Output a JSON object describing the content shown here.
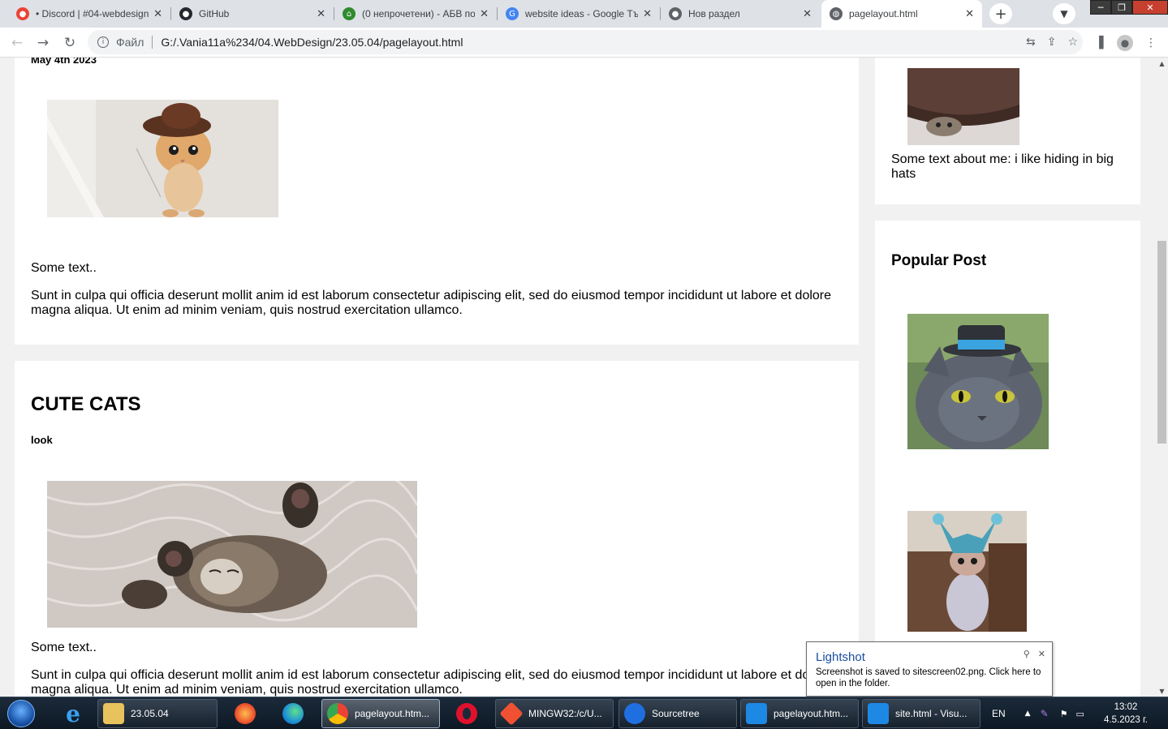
{
  "browser": {
    "tabs": [
      {
        "title": "• Discord | #04-webdesign",
        "icon": "discord-icon",
        "color": "#5865f2"
      },
      {
        "title": "GitHub",
        "icon": "github-icon",
        "color": "#24292f"
      },
      {
        "title": "(0 непрочетени) - АБВ по",
        "icon": "abv-mail-icon",
        "color": "#2e8b2e"
      },
      {
        "title": "website ideas - Google Тъ",
        "icon": "google-icon",
        "color": "#4285f4"
      },
      {
        "title": "Нов раздел",
        "icon": "chrome-icon",
        "color": "#5f6368"
      },
      {
        "title": "pagelayout.html",
        "icon": "globe-icon",
        "color": "#5f6368"
      }
    ],
    "new_tab_symbol": "+",
    "address": {
      "scheme": "Файл",
      "url": "G:/.Vania11a%234/04.WebDesign/23.05.04/pagelayout.html"
    }
  },
  "page": {
    "post1": {
      "date": "May 4th 2023",
      "text_short": "Some text..",
      "text_long": "Sunt in culpa qui officia deserunt mollit anim id est laborum consectetur adipiscing elit, sed do eiusmod tempor incididunt ut labore et dolore magna aliqua. Ut enim ad minim veniam, quis nostrud exercitation ullamco."
    },
    "post2": {
      "title": "CUTE CATS",
      "subtitle": "look",
      "text_short": "Some text..",
      "text_long": "Sunt in culpa qui officia deserunt mollit anim id est laborum consectetur adipiscing elit, sed do eiusmod tempor incididunt ut labore et dolore magna aliqua. Ut enim ad minim veniam, quis nostrud exercitation ullamco."
    },
    "sidebar": {
      "about_text": "Some text about me: i like hiding in big hats",
      "popular_heading": "Popular Post"
    }
  },
  "toast": {
    "title": "Lightshot",
    "body": "Screenshot is saved to sitescreen02.png. Click here to open in the folder."
  },
  "taskbar": {
    "items": [
      {
        "label": "23.05.04",
        "icon": "folder-icon"
      },
      {
        "label": "pagelayout.htm...",
        "icon": "chrome-icon"
      },
      {
        "label": "MINGW32:/c/U...",
        "icon": "git-bash-icon"
      },
      {
        "label": "Sourcetree",
        "icon": "sourcetree-icon"
      },
      {
        "label": "pagelayout.htm...",
        "icon": "vscode-icon"
      },
      {
        "label": "site.html - Visu...",
        "icon": "vscode-icon"
      }
    ],
    "language": "EN",
    "time": "13:02",
    "date": "4.5.2023 г."
  }
}
